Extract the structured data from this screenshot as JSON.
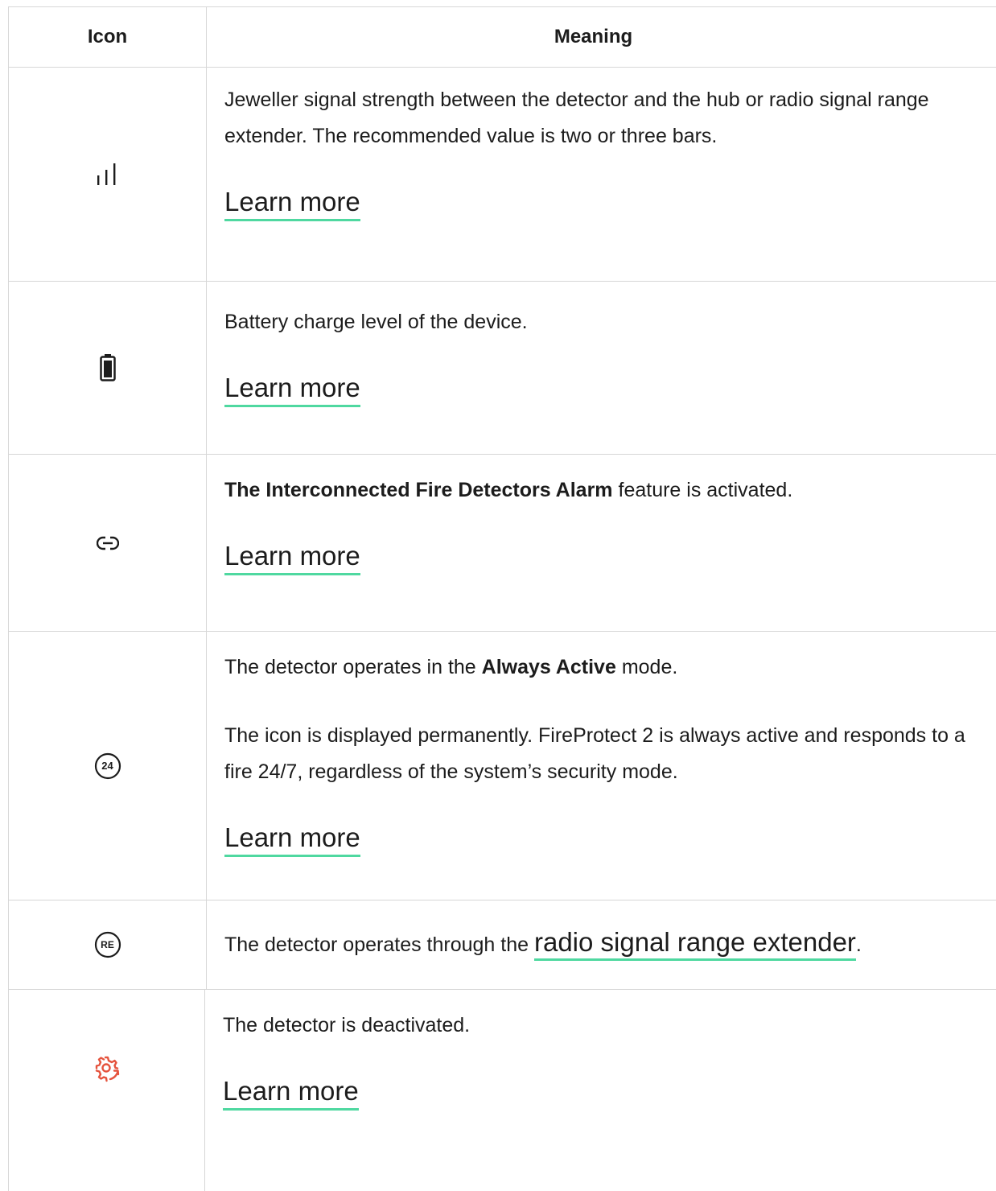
{
  "header": {
    "icon_col": "Icon",
    "meaning_col": "Meaning"
  },
  "rows": [
    {
      "icon": "signal-strength-icon",
      "text": "Jeweller signal strength between the detector and the hub or radio signal range extender. The recommended value is two or three bars.",
      "link": "Learn more"
    },
    {
      "icon": "battery-icon",
      "text": "Battery charge level of the device.",
      "link": "Learn more"
    },
    {
      "icon": "link-icon",
      "bold": "The Interconnected Fire Detectors Alarm",
      "text": " feature is activated.",
      "link": "Learn more"
    },
    {
      "icon": "always-active-24-icon",
      "icon_label": "24",
      "text_a": "The detector operates in the ",
      "bold": "Always Active",
      "text_b": " mode.",
      "text2": "The icon is displayed permanently. FireProtect 2 is always active and responds to a fire 24/7, regardless of the system’s security mode.",
      "link": "Learn more"
    },
    {
      "icon": "range-extender-icon",
      "icon_label": "RE",
      "text": "The detector operates through the ",
      "link": "radio signal range extender",
      "text_after": "."
    },
    {
      "icon": "deactivated-icon",
      "icon_color": "#e5533d",
      "text": "The detector is deactivated.",
      "link": "Learn more"
    }
  ],
  "colors": {
    "link_underline": "#4fd8a0",
    "border": "#d7d7d7",
    "deactivated_icon": "#e5533d"
  }
}
